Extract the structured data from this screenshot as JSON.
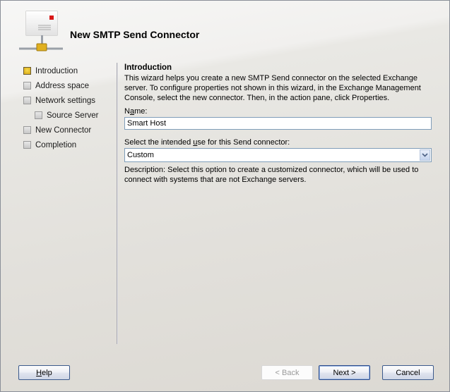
{
  "window": {
    "title": "New SMTP Send Connector",
    "icon": "mail-connector-icon"
  },
  "steps": [
    {
      "label": "Introduction",
      "active": true,
      "level": 0
    },
    {
      "label": "Address space",
      "active": false,
      "level": 0
    },
    {
      "label": "Network settings",
      "active": false,
      "level": 0
    },
    {
      "label": "Source Server",
      "active": false,
      "level": 1
    },
    {
      "label": "New Connector",
      "active": false,
      "level": 0
    },
    {
      "label": "Completion",
      "active": false,
      "level": 0
    }
  ],
  "content": {
    "section_title": "Introduction",
    "intro_text": "This wizard helps you create a new SMTP Send connector on the selected Exchange server. To configure properties not shown in this wizard, in the Exchange Management Console, select the new connector. Then, in the action pane, click Properties.",
    "name_label_pre": "N",
    "name_label_ul": "a",
    "name_label_post": "me:",
    "name_value": "Smart Host",
    "use_label_pre": "Select the intended ",
    "use_label_ul": "u",
    "use_label_post": "se for this Send connector:",
    "use_value": "Custom",
    "description": "Description: Select this option to create a customized connector, which will be used to connect with systems that are not Exchange servers."
  },
  "buttons": {
    "help_ul": "H",
    "help_rest": "elp",
    "back": "< Back",
    "next": "Next >",
    "cancel": "Cancel"
  }
}
